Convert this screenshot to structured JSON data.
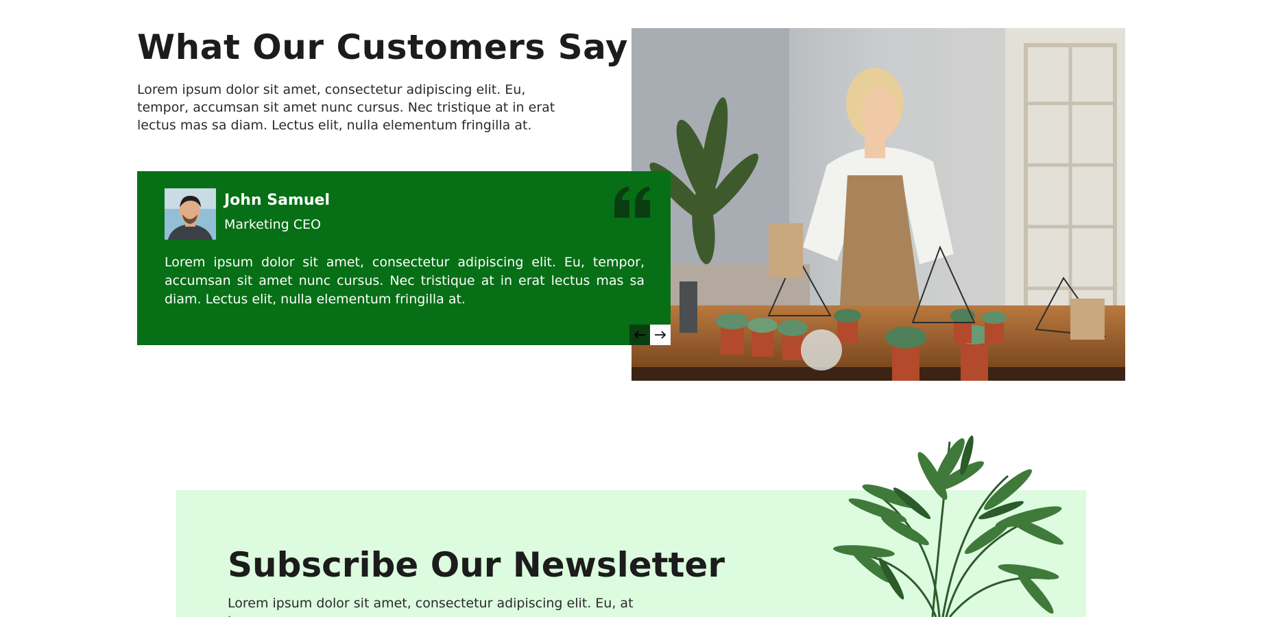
{
  "testimonials": {
    "title": "What Our Customers Say",
    "intro": "Lorem ipsum dolor sit amet, consectetur adipiscing elit. Eu, tempor, accumsan sit amet nunc cursus. Nec tristique at in erat lectus mas sa diam. Lectus elit, nulla elementum fringilla at.",
    "card": {
      "name": "John Samuel",
      "role": "Marketing CEO",
      "quote": "Lorem ipsum dolor sit amet, consectetur adipiscing elit. Eu, tempor, accumsan sit amet nunc cursus. Nec tristique at in erat lectus mas sa diam. Lectus elit, nulla elementum fringilla at."
    },
    "nav": {
      "prev_icon": "arrow-left-icon",
      "next_icon": "arrow-right-icon"
    }
  },
  "newsletter": {
    "title": "Subscribe Our Newsletter",
    "text": "Lorem ipsum dolor sit amet, consectetur adipiscing elit. Eu, at tempor,"
  },
  "colors": {
    "card_green": "#076f15",
    "newsletter_bg": "#dcfbdf",
    "heading": "#1c1c1c"
  }
}
